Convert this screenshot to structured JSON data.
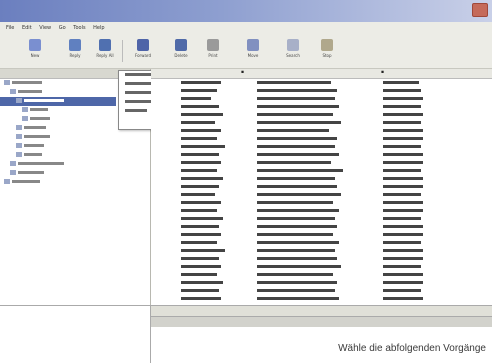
{
  "window": {
    "accent": "#6b7fbf"
  },
  "menubar": {
    "items": [
      "File",
      "Edit",
      "View",
      "Go",
      "Tools",
      "Help"
    ]
  },
  "toolbar": {
    "buttons": [
      {
        "name": "new-icon",
        "label": "New"
      },
      {
        "name": "reply-icon",
        "label": "Reply"
      },
      {
        "name": "reply-all-icon",
        "label": "Reply All"
      },
      {
        "name": "forward-icon",
        "label": "Forward"
      },
      {
        "name": "delete-icon",
        "label": "Delete"
      },
      {
        "name": "print-icon",
        "label": "Print"
      },
      {
        "name": "move-icon",
        "label": "Move"
      },
      {
        "name": "search-icon",
        "label": "Search"
      },
      {
        "name": "stop-icon",
        "label": "Stop"
      }
    ]
  },
  "caption": "Wähle die abfolgenden Vorgänge"
}
